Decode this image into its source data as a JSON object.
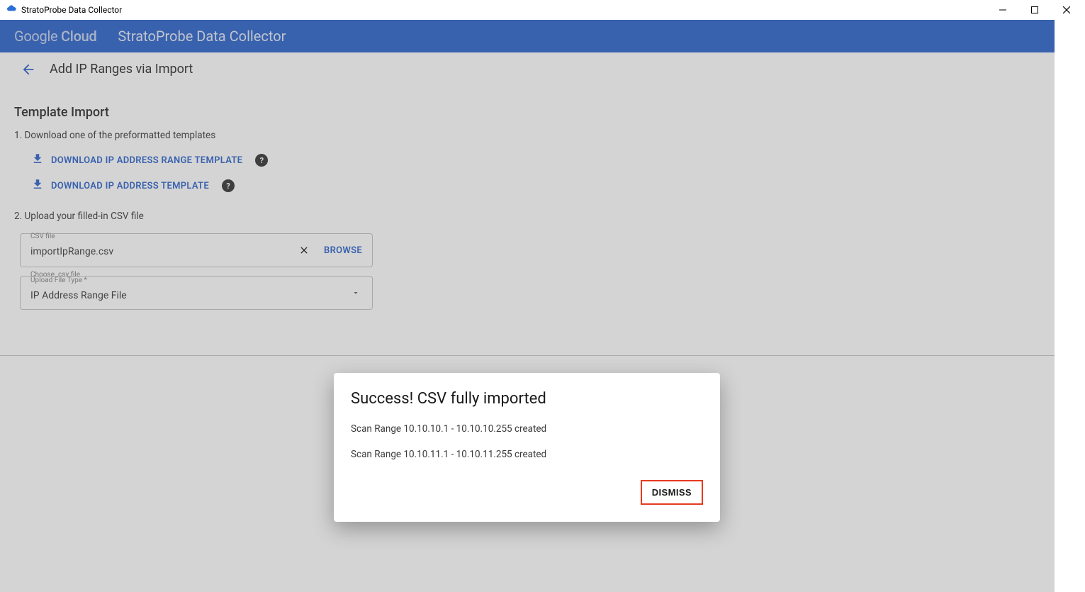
{
  "window": {
    "title": "StratoProbe Data Collector"
  },
  "header": {
    "brand_plain": "Google",
    "brand_bold": "Cloud",
    "app": "StratoProbe Data Collector"
  },
  "subheader": {
    "title": "Add IP Ranges via Import"
  },
  "page": {
    "section_title": "Template Import",
    "step1": "1. Download one of the preformatted templates",
    "download_range": "DOWNLOAD IP ADDRESS RANGE TEMPLATE",
    "download_single": "DOWNLOAD IP ADDRESS TEMPLATE",
    "step2": "2. Upload your filled-in CSV file",
    "csv_field_label": "CSV file",
    "csv_field_value": "importIpRange.csv",
    "browse": "BROWSE",
    "filetype_hint": "Choose .csv file",
    "filetype_label": "Upload File Type *",
    "filetype_value": "IP Address Range File"
  },
  "modal": {
    "title": "Success! CSV fully imported",
    "line1": "Scan Range 10.10.10.1 - 10.10.10.255 created",
    "line2": "Scan Range 10.10.11.1 - 10.10.11.255 created",
    "dismiss": "DISMISS"
  }
}
